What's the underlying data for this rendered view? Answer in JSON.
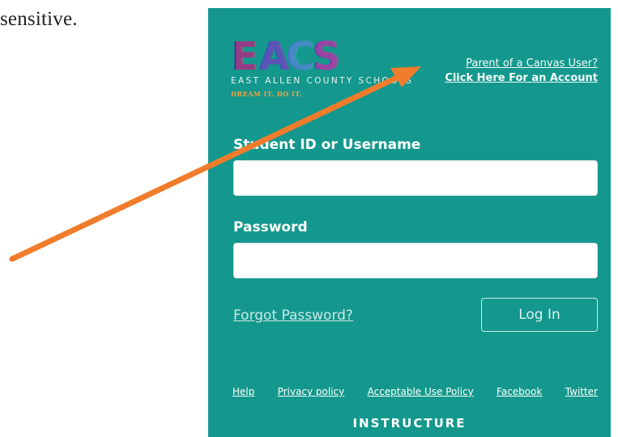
{
  "document": {
    "text": "sensitive."
  },
  "logo": {
    "letters": "EACS",
    "subtitle": "EAST ALLEN COUNTY SCHOOLS",
    "tagline": "DREAM IT. DO IT."
  },
  "parent_link": {
    "line1": "Parent of a Canvas User?",
    "line2": "Click Here For an Account"
  },
  "form": {
    "username_label": "Student ID or Username",
    "password_label": "Password",
    "forgot_link": "Forgot Password?",
    "login_button": "Log In"
  },
  "footer": {
    "links": [
      "Help",
      "Privacy policy",
      "Acceptable Use Policy",
      "Facebook",
      "Twitter"
    ],
    "brand": "INSTRUCTURE"
  },
  "colors": {
    "panel": "#14988d",
    "arrow": "#f07c2c"
  }
}
